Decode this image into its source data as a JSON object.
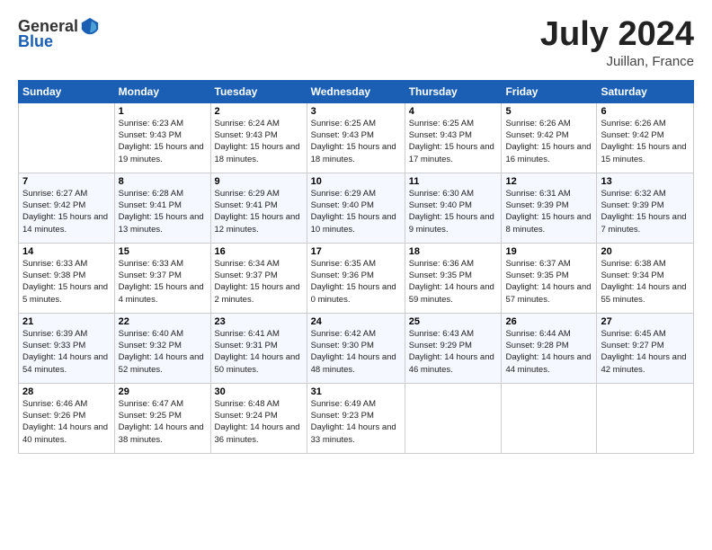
{
  "header": {
    "logo_general": "General",
    "logo_blue": "Blue",
    "month_title": "July 2024",
    "location": "Juillan, France"
  },
  "days_of_week": [
    "Sunday",
    "Monday",
    "Tuesday",
    "Wednesday",
    "Thursday",
    "Friday",
    "Saturday"
  ],
  "weeks": [
    [
      {
        "day": "",
        "sunrise": "",
        "sunset": "",
        "daylight": ""
      },
      {
        "day": "1",
        "sunrise": "Sunrise: 6:23 AM",
        "sunset": "Sunset: 9:43 PM",
        "daylight": "Daylight: 15 hours and 19 minutes."
      },
      {
        "day": "2",
        "sunrise": "Sunrise: 6:24 AM",
        "sunset": "Sunset: 9:43 PM",
        "daylight": "Daylight: 15 hours and 18 minutes."
      },
      {
        "day": "3",
        "sunrise": "Sunrise: 6:25 AM",
        "sunset": "Sunset: 9:43 PM",
        "daylight": "Daylight: 15 hours and 18 minutes."
      },
      {
        "day": "4",
        "sunrise": "Sunrise: 6:25 AM",
        "sunset": "Sunset: 9:43 PM",
        "daylight": "Daylight: 15 hours and 17 minutes."
      },
      {
        "day": "5",
        "sunrise": "Sunrise: 6:26 AM",
        "sunset": "Sunset: 9:42 PM",
        "daylight": "Daylight: 15 hours and 16 minutes."
      },
      {
        "day": "6",
        "sunrise": "Sunrise: 6:26 AM",
        "sunset": "Sunset: 9:42 PM",
        "daylight": "Daylight: 15 hours and 15 minutes."
      }
    ],
    [
      {
        "day": "7",
        "sunrise": "Sunrise: 6:27 AM",
        "sunset": "Sunset: 9:42 PM",
        "daylight": "Daylight: 15 hours and 14 minutes."
      },
      {
        "day": "8",
        "sunrise": "Sunrise: 6:28 AM",
        "sunset": "Sunset: 9:41 PM",
        "daylight": "Daylight: 15 hours and 13 minutes."
      },
      {
        "day": "9",
        "sunrise": "Sunrise: 6:29 AM",
        "sunset": "Sunset: 9:41 PM",
        "daylight": "Daylight: 15 hours and 12 minutes."
      },
      {
        "day": "10",
        "sunrise": "Sunrise: 6:29 AM",
        "sunset": "Sunset: 9:40 PM",
        "daylight": "Daylight: 15 hours and 10 minutes."
      },
      {
        "day": "11",
        "sunrise": "Sunrise: 6:30 AM",
        "sunset": "Sunset: 9:40 PM",
        "daylight": "Daylight: 15 hours and 9 minutes."
      },
      {
        "day": "12",
        "sunrise": "Sunrise: 6:31 AM",
        "sunset": "Sunset: 9:39 PM",
        "daylight": "Daylight: 15 hours and 8 minutes."
      },
      {
        "day": "13",
        "sunrise": "Sunrise: 6:32 AM",
        "sunset": "Sunset: 9:39 PM",
        "daylight": "Daylight: 15 hours and 7 minutes."
      }
    ],
    [
      {
        "day": "14",
        "sunrise": "Sunrise: 6:33 AM",
        "sunset": "Sunset: 9:38 PM",
        "daylight": "Daylight: 15 hours and 5 minutes."
      },
      {
        "day": "15",
        "sunrise": "Sunrise: 6:33 AM",
        "sunset": "Sunset: 9:37 PM",
        "daylight": "Daylight: 15 hours and 4 minutes."
      },
      {
        "day": "16",
        "sunrise": "Sunrise: 6:34 AM",
        "sunset": "Sunset: 9:37 PM",
        "daylight": "Daylight: 15 hours and 2 minutes."
      },
      {
        "day": "17",
        "sunrise": "Sunrise: 6:35 AM",
        "sunset": "Sunset: 9:36 PM",
        "daylight": "Daylight: 15 hours and 0 minutes."
      },
      {
        "day": "18",
        "sunrise": "Sunrise: 6:36 AM",
        "sunset": "Sunset: 9:35 PM",
        "daylight": "Daylight: 14 hours and 59 minutes."
      },
      {
        "day": "19",
        "sunrise": "Sunrise: 6:37 AM",
        "sunset": "Sunset: 9:35 PM",
        "daylight": "Daylight: 14 hours and 57 minutes."
      },
      {
        "day": "20",
        "sunrise": "Sunrise: 6:38 AM",
        "sunset": "Sunset: 9:34 PM",
        "daylight": "Daylight: 14 hours and 55 minutes."
      }
    ],
    [
      {
        "day": "21",
        "sunrise": "Sunrise: 6:39 AM",
        "sunset": "Sunset: 9:33 PM",
        "daylight": "Daylight: 14 hours and 54 minutes."
      },
      {
        "day": "22",
        "sunrise": "Sunrise: 6:40 AM",
        "sunset": "Sunset: 9:32 PM",
        "daylight": "Daylight: 14 hours and 52 minutes."
      },
      {
        "day": "23",
        "sunrise": "Sunrise: 6:41 AM",
        "sunset": "Sunset: 9:31 PM",
        "daylight": "Daylight: 14 hours and 50 minutes."
      },
      {
        "day": "24",
        "sunrise": "Sunrise: 6:42 AM",
        "sunset": "Sunset: 9:30 PM",
        "daylight": "Daylight: 14 hours and 48 minutes."
      },
      {
        "day": "25",
        "sunrise": "Sunrise: 6:43 AM",
        "sunset": "Sunset: 9:29 PM",
        "daylight": "Daylight: 14 hours and 46 minutes."
      },
      {
        "day": "26",
        "sunrise": "Sunrise: 6:44 AM",
        "sunset": "Sunset: 9:28 PM",
        "daylight": "Daylight: 14 hours and 44 minutes."
      },
      {
        "day": "27",
        "sunrise": "Sunrise: 6:45 AM",
        "sunset": "Sunset: 9:27 PM",
        "daylight": "Daylight: 14 hours and 42 minutes."
      }
    ],
    [
      {
        "day": "28",
        "sunrise": "Sunrise: 6:46 AM",
        "sunset": "Sunset: 9:26 PM",
        "daylight": "Daylight: 14 hours and 40 minutes."
      },
      {
        "day": "29",
        "sunrise": "Sunrise: 6:47 AM",
        "sunset": "Sunset: 9:25 PM",
        "daylight": "Daylight: 14 hours and 38 minutes."
      },
      {
        "day": "30",
        "sunrise": "Sunrise: 6:48 AM",
        "sunset": "Sunset: 9:24 PM",
        "daylight": "Daylight: 14 hours and 36 minutes."
      },
      {
        "day": "31",
        "sunrise": "Sunrise: 6:49 AM",
        "sunset": "Sunset: 9:23 PM",
        "daylight": "Daylight: 14 hours and 33 minutes."
      },
      {
        "day": "",
        "sunrise": "",
        "sunset": "",
        "daylight": ""
      },
      {
        "day": "",
        "sunrise": "",
        "sunset": "",
        "daylight": ""
      },
      {
        "day": "",
        "sunrise": "",
        "sunset": "",
        "daylight": ""
      }
    ]
  ]
}
